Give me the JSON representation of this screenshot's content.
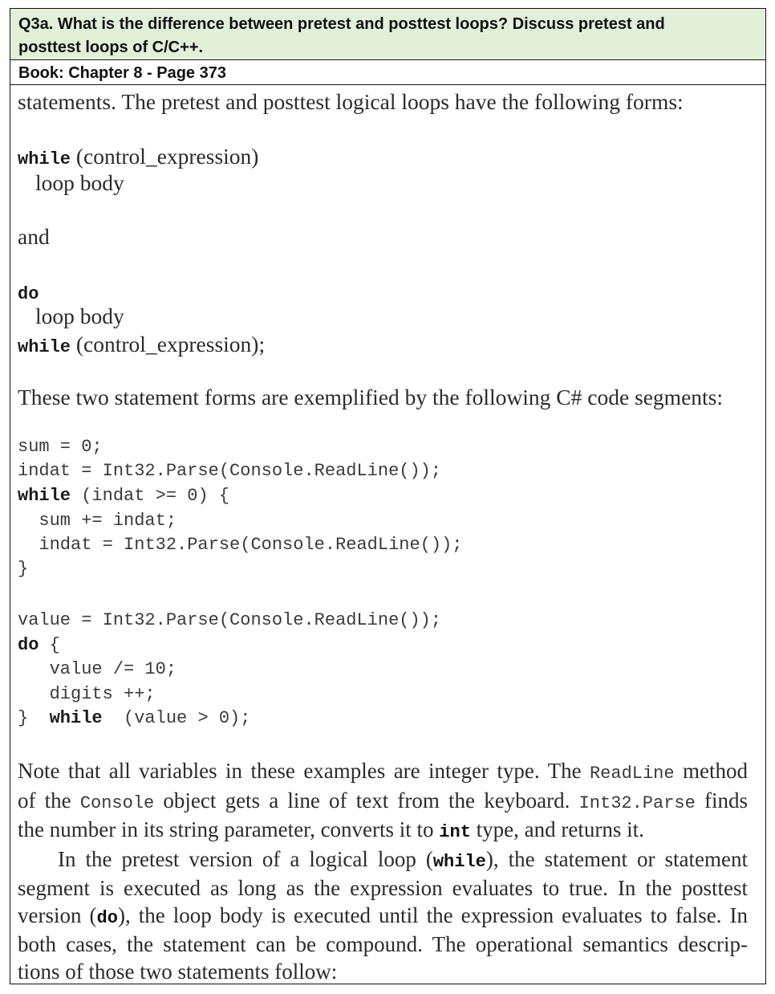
{
  "question": {
    "line1": "Q3a. What is the difference between pretest and posttest loops? Discuss pretest and",
    "line2": "posttest loops of C/C++."
  },
  "book_ref": "Book: Chapter 8 - Page 373",
  "intro": "statements. The pretest and posttest logical loops have the following forms:",
  "forms": {
    "while_kw": "while",
    "while_cond": "(control_expression)",
    "loop_body": "loop body",
    "and": "and",
    "do_kw": "do",
    "do_while_cond": "(control_expression);"
  },
  "exemplified": "These two statement forms are exemplified by the following C# code segments:",
  "code1": [
    "sum = 0;",
    "indat = Int32.Parse(Console.ReadLine());",
    "  sum += indat;",
    "  indat = Int32.Parse(Console.ReadLine());",
    "}"
  ],
  "code1_while": {
    "kw": "while",
    "rest": " (indat >= 0) {"
  },
  "code2": [
    "value = Int32.Parse(Console.ReadLine());",
    "   value /= 10;",
    "   digits ++;"
  ],
  "code2_do": {
    "kw": "do",
    "rest": " {"
  },
  "code2_end": {
    "pre": "}  ",
    "kw": "while",
    "rest": "  (value > 0);"
  },
  "note": {
    "l1a": "Note that all variables in these examples are integer type. The ",
    "l1code": "ReadLine",
    "l1b": " method",
    "l2a": "of the ",
    "l2code": "Console",
    "l2b": " object gets a line of text from the keyboard. ",
    "l2code2": "Int32.Parse",
    "l2c": " finds",
    "l3a": "the number in its string parameter, converts it to ",
    "l3code": "int",
    "l3b": " type, and returns it.",
    "l4a": "In the pretest version of a logical loop (",
    "l4code": "while",
    "l4b": "), the statement or statement",
    "l5": "segment is executed as long as the expression evaluates to true. In the posttest",
    "l6a": "version (",
    "l6code": "do",
    "l6b": "), the loop body is executed until the expression evaluates to false. In",
    "l7": "both cases, the statement can be compound. The operational semantics descrip-",
    "l8": "tions of those two statements follow:"
  }
}
